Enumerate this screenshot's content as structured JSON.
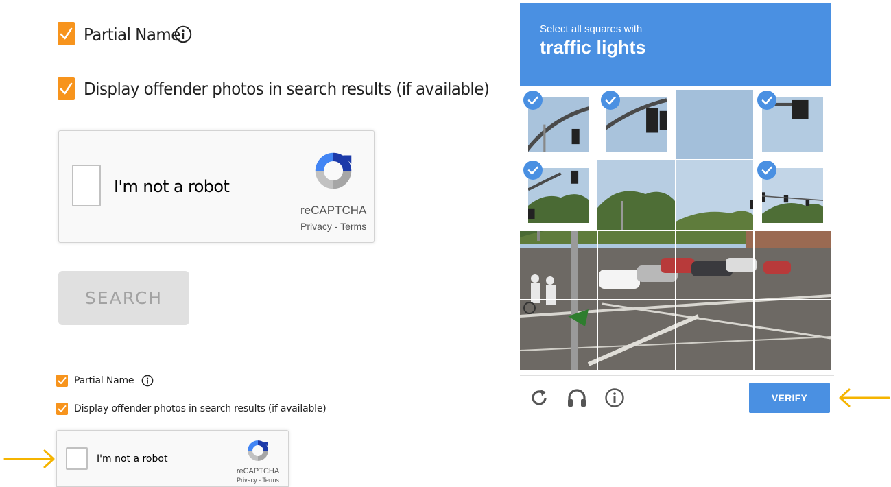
{
  "top_form": {
    "partial_name_label": "Partial Name",
    "display_photos_label": "Display offender photos in search results (if available)",
    "search_button": "SEARCH"
  },
  "recaptcha": {
    "checkbox_label": "I'm not a robot",
    "brand": "reCAPTCHA",
    "links": "Privacy - Terms"
  },
  "bottom_form": {
    "partial_name_label": "Partial Name",
    "display_photos_label": "Display offender photos in search results (if available)"
  },
  "bottom_recaptcha": {
    "checkbox_label": "I'm not a robot",
    "brand": "reCAPTCHA",
    "links": "Privacy - Terms"
  },
  "challenge": {
    "instruction": "Select all squares with",
    "target": "traffic lights",
    "selected_tiles": [
      0,
      1,
      3,
      4,
      7
    ],
    "footer_icons": [
      "reload-icon",
      "audio-headphones-icon",
      "info-icon"
    ],
    "verify_button": "VERIFY"
  },
  "colors": {
    "checkbox_orange": "#f7941d",
    "captcha_blue": "#4a90e2",
    "arrow_yellow": "#f5b400"
  }
}
